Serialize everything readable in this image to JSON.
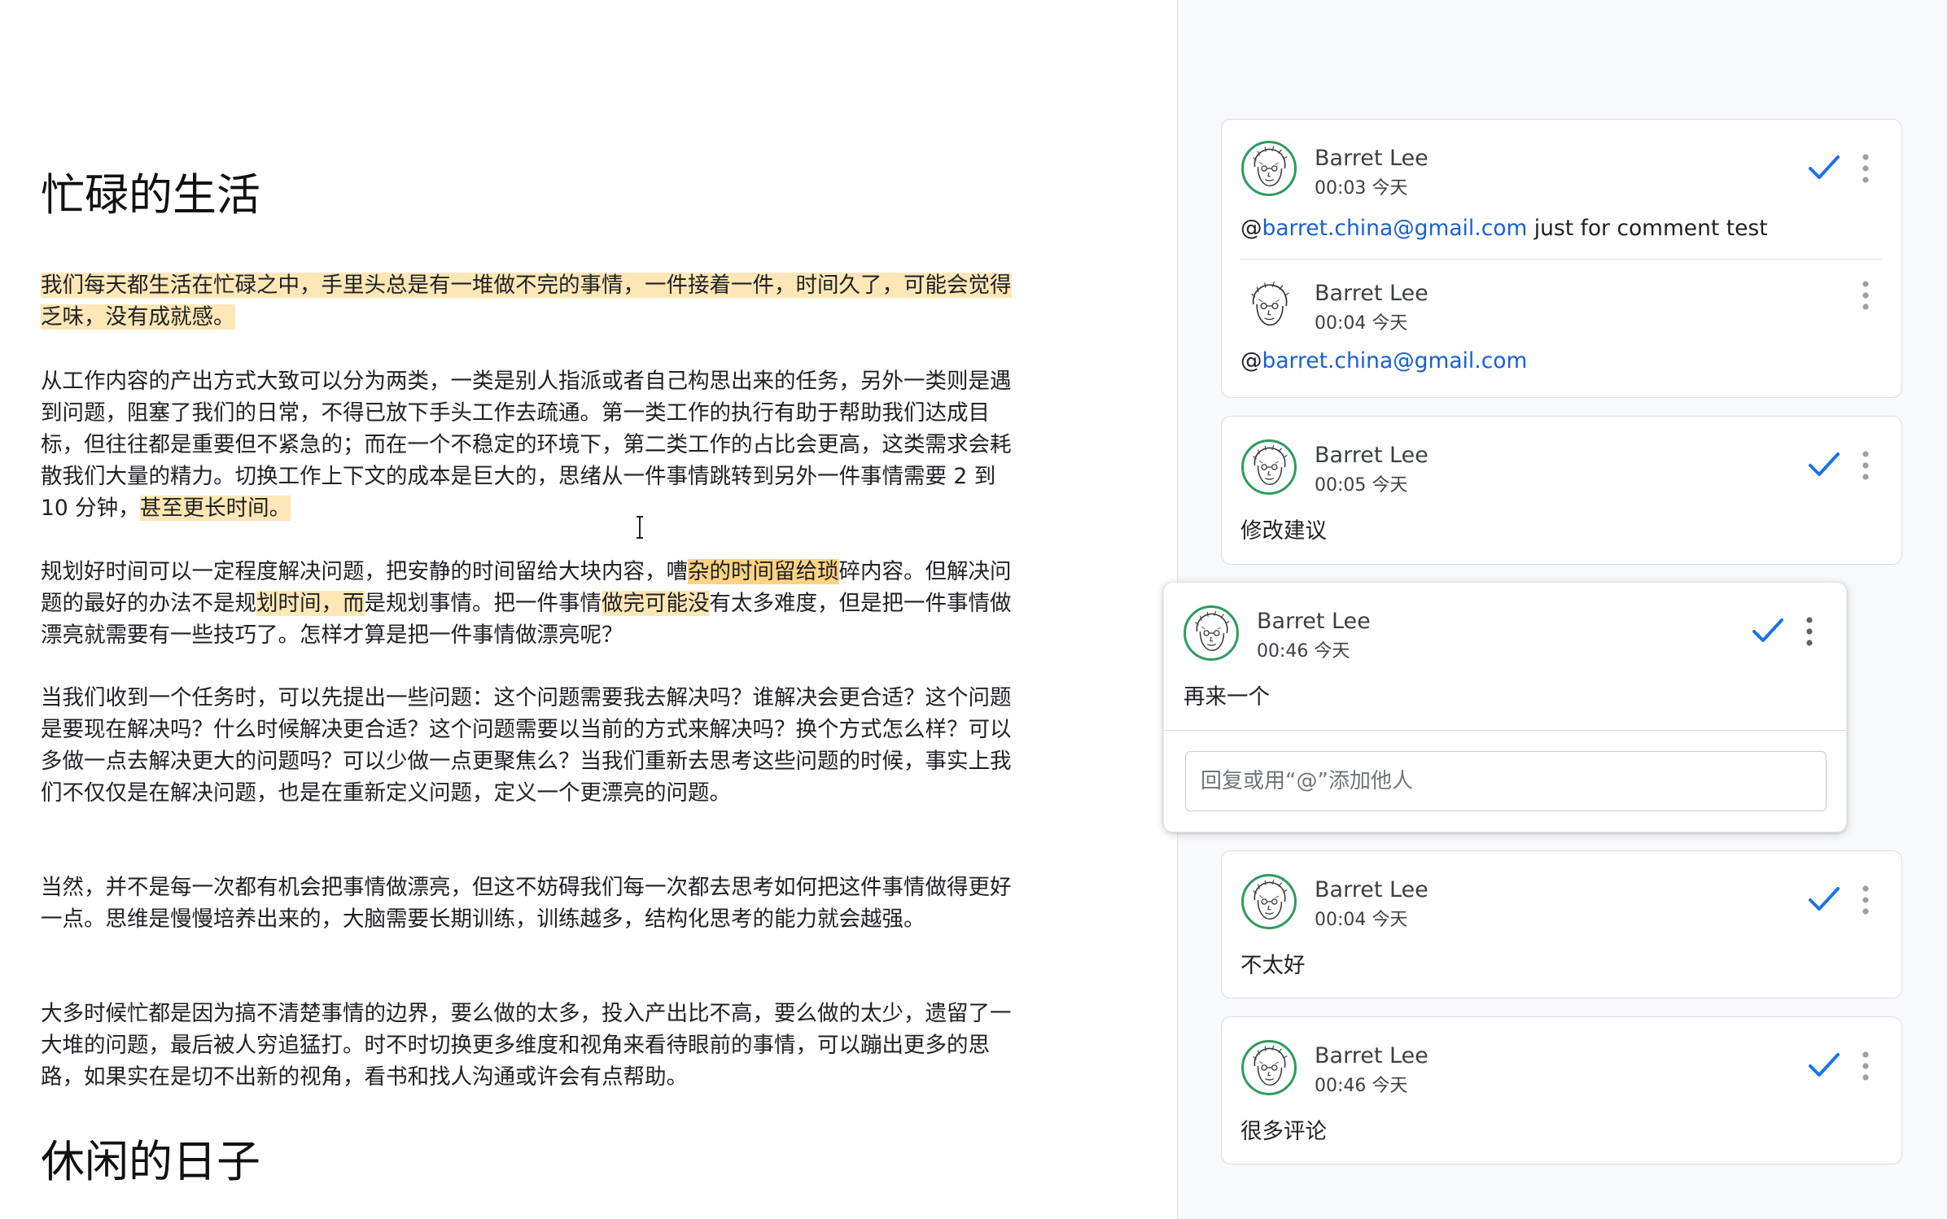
{
  "document": {
    "heading1": "忙碌的生活",
    "p1": {
      "hl": "我们每天都生活在忙碌之中，手里头总是有一堆做不完的事情，一件接着一件，时间久了，可能会觉得乏味，没有成就感。"
    },
    "p2": {
      "before": "从工作内容的产出方式大致可以分为两类，一类是别人指派或者自己构思出来的任务，另外一类则是遇到问题，阻塞了我们的日常，不得已放下手头工作去疏通。第一类工作的执行有助于帮助我们达成目标，但往往都是重要但不紧急的；而在一个不稳定的环境下，第二类工作的占比会更高，这类需求会耗散我们大量的精力。切换工作上下文的成本是巨大的，思绪从一件事情跳转到另外一件事情需要 2 到 10 分钟，",
      "hl": "甚至更长时间。"
    },
    "p3": {
      "s1": "规划好时间可以一定程度解决问题，把安静的时间留给大块内容，嘈",
      "h1": "杂的时间留给琐",
      "s2": "碎内容。但解决问题的最好的办法不是规",
      "h2": "划时间，而",
      "s3": "是规划事情。把一件事情",
      "h3": "做完可能没",
      "s4": "有太多难度，但是把一件事情做漂亮就需要有一些技巧了。怎样才算是把一件事情做漂亮呢？"
    },
    "p4": "当我们收到一个任务时，可以先提出一些问题：这个问题需要我去解决吗？谁解决会更合适？这个问题是要现在解决吗？什么时候解决更合适？这个问题需要以当前的方式来解决吗？换个方式怎么样？可以多做一点去解决更大的问题吗？可以少做一点更聚焦么？当我们重新去思考这些问题的时候，事实上我们不仅仅是在解决问题，也是在重新定义问题，定义一个更漂亮的问题。",
    "p5": "当然，并不是每一次都有机会把事情做漂亮，但这不妨碍我们每一次都去思考如何把这件事情做得更好一点。思维是慢慢培养出来的，大脑需要长期训练，训练越多，结构化思考的能力就会越强。",
    "p6": "大多时候忙都是因为搞不清楚事情的边界，要么做的太多，投入产出比不高，要么做的太少，遗留了一大堆的问题，最后被人穷追猛打。时不时切换更多维度和视角来看待眼前的事情，可以蹦出更多的思路，如果实在是切不出新的视角，看书和找人沟通或许会有点帮助。",
    "heading2": "休闲的日子"
  },
  "comments": {
    "c1": {
      "author": "Barret Lee",
      "time": "00:03 今天",
      "at": "@",
      "mention": "barret.china@gmail.com",
      "rest": " just for comment test",
      "reply": {
        "author": "Barret Lee",
        "time": "00:04 今天",
        "at": "@",
        "mention": "barret.china@gmail.com"
      }
    },
    "c2": {
      "author": "Barret Lee",
      "time": "00:05 今天",
      "text": "修改建议"
    },
    "c3": {
      "author": "Barret Lee",
      "time": "00:46 今天",
      "text": "再来一个",
      "reply_placeholder": "回复或用“@”添加他人"
    },
    "c4": {
      "author": "Barret Lee",
      "time": "00:04 今天",
      "text": "不太好"
    },
    "c5": {
      "author": "Barret Lee",
      "time": "00:46 今天",
      "text": "很多评论"
    }
  },
  "colors": {
    "highlight_light": "#fde7b7",
    "highlight_strong": "#fbd383",
    "check_blue": "#1a73e8",
    "avatar_ring": "#2e9b5f",
    "mention": "#1a5fd0"
  },
  "icons": [
    "resolve-check-icon",
    "more-vert-icon",
    "avatar-icon",
    "text-cursor-icon"
  ]
}
